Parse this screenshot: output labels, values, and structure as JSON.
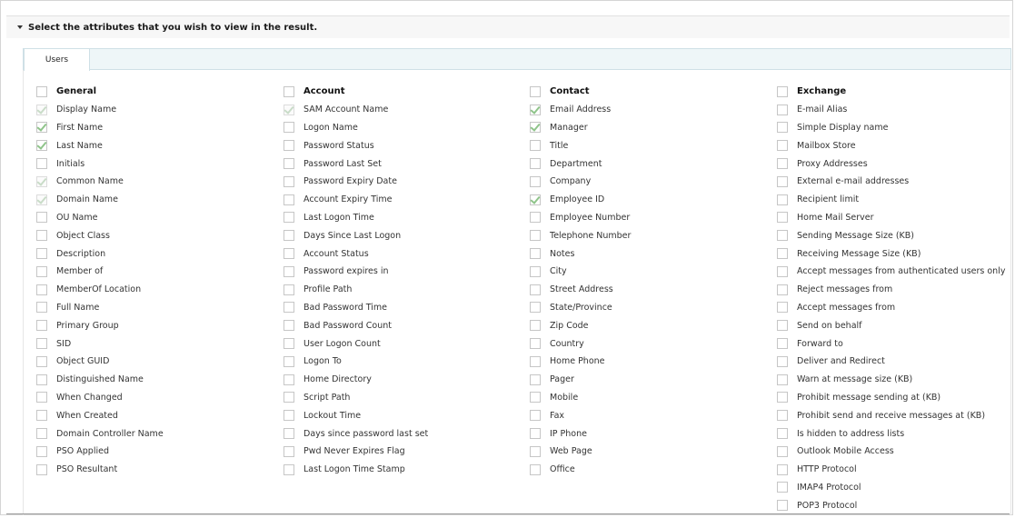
{
  "section": {
    "title": "Select the attributes that you wish to view in the result."
  },
  "tabs": [
    {
      "label": "Users"
    }
  ],
  "columns": [
    {
      "header": "General",
      "items": [
        {
          "label": "Display Name",
          "checked": true,
          "disabled": true
        },
        {
          "label": "First Name",
          "checked": true,
          "disabled": false
        },
        {
          "label": "Last Name",
          "checked": true,
          "disabled": false
        },
        {
          "label": "Initials",
          "checked": false,
          "disabled": false
        },
        {
          "label": "Common Name",
          "checked": true,
          "disabled": true
        },
        {
          "label": "Domain Name",
          "checked": true,
          "disabled": true
        },
        {
          "label": "OU Name",
          "checked": false,
          "disabled": false
        },
        {
          "label": "Object Class",
          "checked": false,
          "disabled": false
        },
        {
          "label": "Description",
          "checked": false,
          "disabled": false
        },
        {
          "label": "Member of",
          "checked": false,
          "disabled": false
        },
        {
          "label": "MemberOf Location",
          "checked": false,
          "disabled": false
        },
        {
          "label": "Full Name",
          "checked": false,
          "disabled": false
        },
        {
          "label": "Primary Group",
          "checked": false,
          "disabled": false
        },
        {
          "label": "SID",
          "checked": false,
          "disabled": false
        },
        {
          "label": "Object GUID",
          "checked": false,
          "disabled": false
        },
        {
          "label": "Distinguished Name",
          "checked": false,
          "disabled": false
        },
        {
          "label": "When Changed",
          "checked": false,
          "disabled": false
        },
        {
          "label": "When Created",
          "checked": false,
          "disabled": false
        },
        {
          "label": "Domain Controller Name",
          "checked": false,
          "disabled": false
        },
        {
          "label": "PSO Applied",
          "checked": false,
          "disabled": false
        },
        {
          "label": "PSO Resultant",
          "checked": false,
          "disabled": false
        }
      ]
    },
    {
      "header": "Account",
      "items": [
        {
          "label": "SAM Account Name",
          "checked": true,
          "disabled": true
        },
        {
          "label": "Logon Name",
          "checked": false,
          "disabled": false
        },
        {
          "label": "Password Status",
          "checked": false,
          "disabled": false
        },
        {
          "label": "Password Last Set",
          "checked": false,
          "disabled": false
        },
        {
          "label": "Password Expiry Date",
          "checked": false,
          "disabled": false
        },
        {
          "label": "Account Expiry Time",
          "checked": false,
          "disabled": false
        },
        {
          "label": "Last Logon Time",
          "checked": false,
          "disabled": false
        },
        {
          "label": "Days Since Last Logon",
          "checked": false,
          "disabled": false
        },
        {
          "label": "Account Status",
          "checked": false,
          "disabled": false
        },
        {
          "label": "Password expires in",
          "checked": false,
          "disabled": false
        },
        {
          "label": "Profile Path",
          "checked": false,
          "disabled": false
        },
        {
          "label": "Bad Password Time",
          "checked": false,
          "disabled": false
        },
        {
          "label": "Bad Password Count",
          "checked": false,
          "disabled": false
        },
        {
          "label": "User Logon Count",
          "checked": false,
          "disabled": false
        },
        {
          "label": "Logon To",
          "checked": false,
          "disabled": false
        },
        {
          "label": "Home Directory",
          "checked": false,
          "disabled": false
        },
        {
          "label": "Script Path",
          "checked": false,
          "disabled": false
        },
        {
          "label": "Lockout Time",
          "checked": false,
          "disabled": false
        },
        {
          "label": "Days since password last set",
          "checked": false,
          "disabled": false
        },
        {
          "label": "Pwd Never Expires Flag",
          "checked": false,
          "disabled": false
        },
        {
          "label": "Last Logon Time Stamp",
          "checked": false,
          "disabled": false
        }
      ]
    },
    {
      "header": "Contact",
      "items": [
        {
          "label": "Email Address",
          "checked": true,
          "disabled": false
        },
        {
          "label": "Manager",
          "checked": true,
          "disabled": false
        },
        {
          "label": "Title",
          "checked": false,
          "disabled": false
        },
        {
          "label": "Department",
          "checked": false,
          "disabled": false
        },
        {
          "label": "Company",
          "checked": false,
          "disabled": false
        },
        {
          "label": "Employee ID",
          "checked": true,
          "disabled": false
        },
        {
          "label": "Employee Number",
          "checked": false,
          "disabled": false
        },
        {
          "label": "Telephone Number",
          "checked": false,
          "disabled": false
        },
        {
          "label": "Notes",
          "checked": false,
          "disabled": false
        },
        {
          "label": "City",
          "checked": false,
          "disabled": false
        },
        {
          "label": "Street Address",
          "checked": false,
          "disabled": false
        },
        {
          "label": "State/Province",
          "checked": false,
          "disabled": false
        },
        {
          "label": "Zip Code",
          "checked": false,
          "disabled": false
        },
        {
          "label": "Country",
          "checked": false,
          "disabled": false
        },
        {
          "label": "Home Phone",
          "checked": false,
          "disabled": false
        },
        {
          "label": "Pager",
          "checked": false,
          "disabled": false
        },
        {
          "label": "Mobile",
          "checked": false,
          "disabled": false
        },
        {
          "label": "Fax",
          "checked": false,
          "disabled": false
        },
        {
          "label": "IP Phone",
          "checked": false,
          "disabled": false
        },
        {
          "label": "Web Page",
          "checked": false,
          "disabled": false
        },
        {
          "label": "Office",
          "checked": false,
          "disabled": false
        }
      ]
    },
    {
      "header": "Exchange",
      "items": [
        {
          "label": "E-mail Alias",
          "checked": false,
          "disabled": false
        },
        {
          "label": "Simple Display name",
          "checked": false,
          "disabled": false
        },
        {
          "label": "Mailbox Store",
          "checked": false,
          "disabled": false
        },
        {
          "label": "Proxy Addresses",
          "checked": false,
          "disabled": false
        },
        {
          "label": "External e-mail addresses",
          "checked": false,
          "disabled": false
        },
        {
          "label": "Recipient limit",
          "checked": false,
          "disabled": false
        },
        {
          "label": "Home Mail Server",
          "checked": false,
          "disabled": false
        },
        {
          "label": "Sending Message Size (KB)",
          "checked": false,
          "disabled": false
        },
        {
          "label": "Receiving Message Size (KB)",
          "checked": false,
          "disabled": false
        },
        {
          "label": "Accept messages from authenticated users only",
          "checked": false,
          "disabled": false
        },
        {
          "label": "Reject messages from",
          "checked": false,
          "disabled": false
        },
        {
          "label": "Accept messages from",
          "checked": false,
          "disabled": false
        },
        {
          "label": "Send on behalf",
          "checked": false,
          "disabled": false
        },
        {
          "label": "Forward to",
          "checked": false,
          "disabled": false
        },
        {
          "label": "Deliver and Redirect",
          "checked": false,
          "disabled": false
        },
        {
          "label": "Warn at message size (KB)",
          "checked": false,
          "disabled": false
        },
        {
          "label": "Prohibit message sending at (KB)",
          "checked": false,
          "disabled": false
        },
        {
          "label": "Prohibit send and receive messages at (KB)",
          "checked": false,
          "disabled": false
        },
        {
          "label": "Is hidden to address lists",
          "checked": false,
          "disabled": false
        },
        {
          "label": "Outlook Mobile Access",
          "checked": false,
          "disabled": false
        },
        {
          "label": "HTTP Protocol",
          "checked": false,
          "disabled": false
        },
        {
          "label": "IMAP4 Protocol",
          "checked": false,
          "disabled": false
        },
        {
          "label": "POP3 Protocol",
          "checked": false,
          "disabled": false
        }
      ]
    }
  ]
}
